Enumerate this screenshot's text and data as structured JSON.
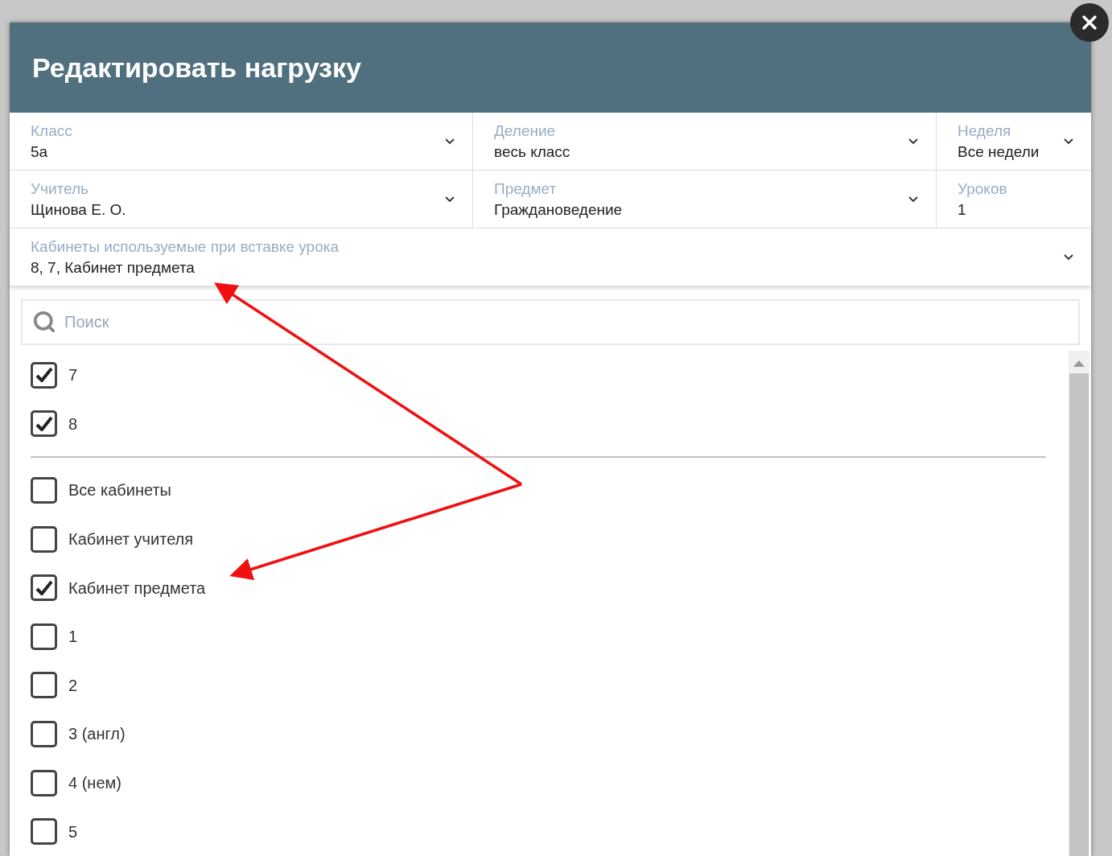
{
  "dialog": {
    "title": "Редактировать нагрузку",
    "field_rows": [
      [
        {
          "label": "Класс",
          "value": "5а",
          "dropdown": true
        },
        {
          "label": "Деление",
          "value": "весь класс",
          "dropdown": true
        },
        {
          "label": "Неделя",
          "value": "Все недели",
          "dropdown": true
        }
      ],
      [
        {
          "label": "Учитель",
          "value": "Щинова Е. О.",
          "dropdown": true
        },
        {
          "label": "Предмет",
          "value": "Граждановедение",
          "dropdown": true
        },
        {
          "label": "Уроков",
          "value": "1",
          "dropdown": false
        }
      ]
    ],
    "rooms_field": {
      "label": "Кабинеты используемые при вставке урока",
      "value": "8, 7, Кабинет предмета",
      "dropdown": true
    },
    "picker": {
      "search": {
        "placeholder": "Поиск"
      },
      "selected_options": [
        {
          "label": "7",
          "checked": true
        },
        {
          "label": "8",
          "checked": true
        }
      ],
      "options": [
        {
          "label": "Все кабинеты",
          "checked": false
        },
        {
          "label": "Кабинет учителя",
          "checked": false
        },
        {
          "label": "Кабинет предмета",
          "checked": true
        },
        {
          "label": "1",
          "checked": false
        },
        {
          "label": "2",
          "checked": false
        },
        {
          "label": "3 (англ)",
          "checked": false
        },
        {
          "label": "4 (нем)",
          "checked": false
        },
        {
          "label": "5",
          "checked": false
        }
      ]
    }
  }
}
